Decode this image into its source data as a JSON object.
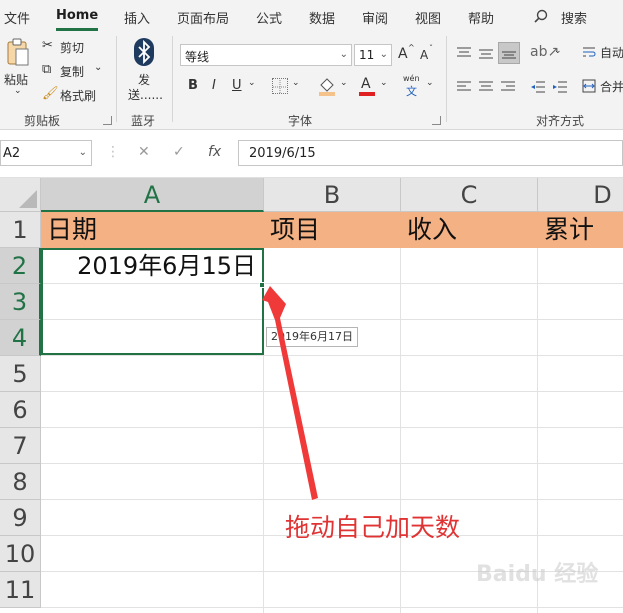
{
  "ribbon_tabs": [
    "文件",
    "Home",
    "插入",
    "页面布局",
    "公式",
    "数据",
    "审阅",
    "视图",
    "帮助"
  ],
  "search_label": "搜索",
  "clipboard": {
    "paste": "粘贴",
    "cut": "剪切",
    "copy": "复制",
    "format_painter": "格式刷",
    "group_label": "剪贴板"
  },
  "bluetooth": {
    "send_line1": "发",
    "send_line2": "送......",
    "group_label": "蓝牙"
  },
  "font": {
    "name": "等线",
    "size": "11",
    "grow": "A",
    "shrink": "A",
    "bold": "B",
    "italic": "I",
    "underline": "U",
    "font_color": "A",
    "phonetic_top": "wén",
    "phonetic_bottom": "文",
    "group_label": "字体"
  },
  "alignment": {
    "wrap": "自动",
    "merge": "合并",
    "group_label": "对齐方式"
  },
  "formula_bar": {
    "name_box": "A2",
    "cancel": "✕",
    "enter": "✓",
    "fx": "fx",
    "value": "2019/6/15"
  },
  "columns": [
    "A",
    "B",
    "C",
    "D"
  ],
  "rows": [
    "1",
    "2",
    "3",
    "4",
    "5",
    "6",
    "7",
    "8",
    "9",
    "10",
    "11"
  ],
  "header_row": {
    "A": "日期",
    "B": "项目",
    "C": "收入",
    "D": "累计"
  },
  "cell_A2": "2019年6月15日",
  "autofill_tooltip": "2019年6月17日",
  "annotation": "拖动自己加天数",
  "watermark": "Baidu 经验",
  "colors": {
    "accent": "#217346",
    "header_fill": "#f4b183",
    "annotation": "#e03333"
  }
}
